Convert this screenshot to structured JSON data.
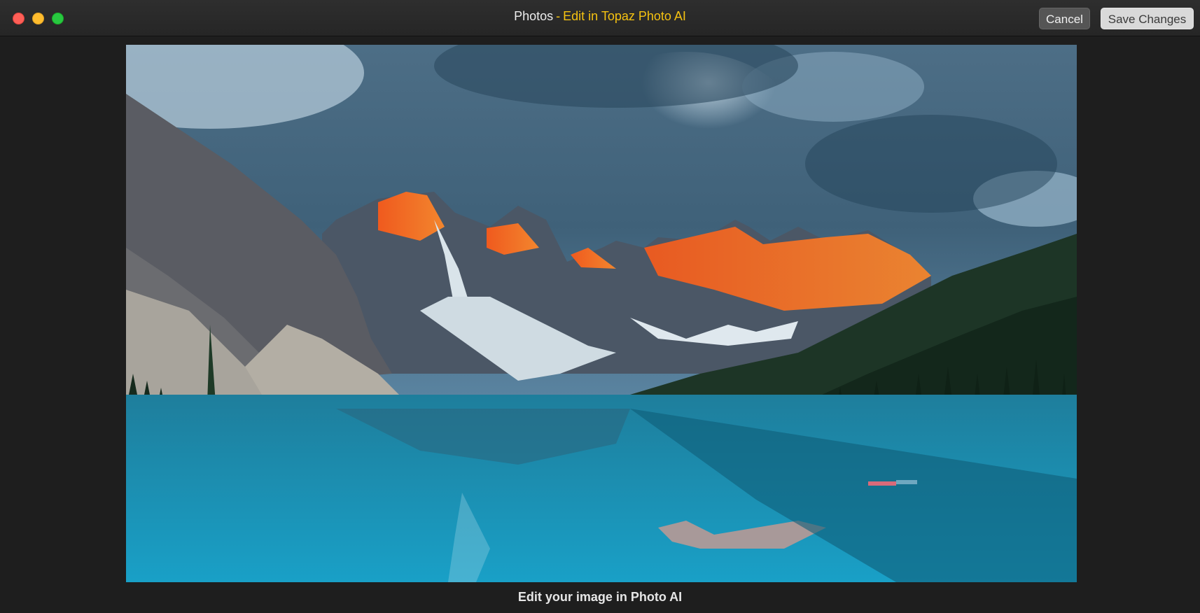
{
  "window": {
    "title_app": "Photos",
    "title_separator": "-",
    "title_action": "Edit in Topaz Photo AI",
    "controls": [
      "close",
      "minimize",
      "zoom"
    ]
  },
  "toolbar": {
    "cancel_label": "Cancel",
    "save_label": "Save Changes"
  },
  "image": {
    "subject": "mountain lake landscape"
  },
  "caption": "Edit your image in Photo AI",
  "colors": {
    "accent": "#f5c211",
    "window_bg": "#1e1e1e",
    "titlebar_bg": "#2a2a2a"
  }
}
